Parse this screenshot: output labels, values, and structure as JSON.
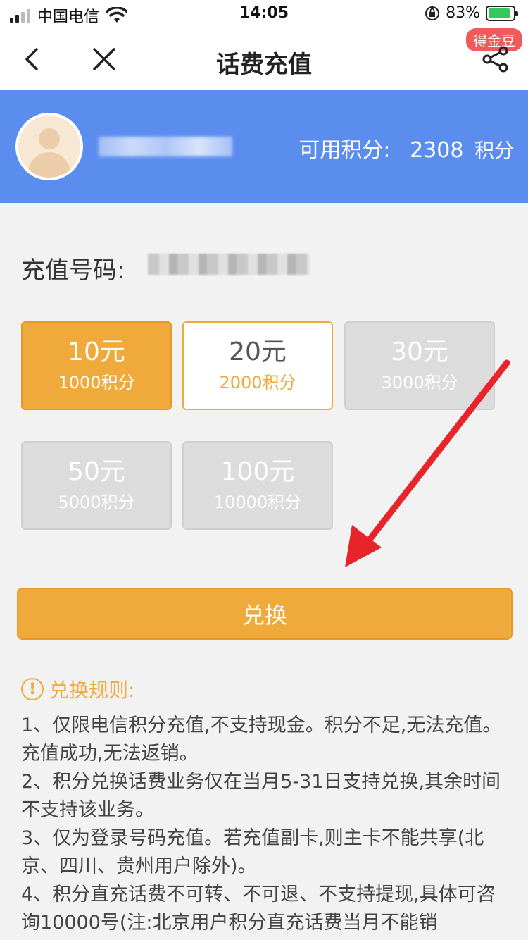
{
  "status_bar": {
    "carrier": "中国电信",
    "time": "14:05",
    "battery_percent": "83%"
  },
  "nav": {
    "title": "话费充值",
    "badge": "得金豆"
  },
  "header": {
    "points_label": "可用积分:",
    "points_value": "2308",
    "points_unit": "积分"
  },
  "recharge": {
    "number_label": "充值号码:"
  },
  "options": [
    {
      "amount": "10元",
      "points": "1000积分",
      "state": "selected"
    },
    {
      "amount": "20元",
      "points": "2000积分",
      "state": "available"
    },
    {
      "amount": "30元",
      "points": "3000积分",
      "state": "disabled"
    },
    {
      "amount": "50元",
      "points": "5000积分",
      "state": "disabled"
    },
    {
      "amount": "100元",
      "points": "10000积分",
      "state": "disabled"
    }
  ],
  "exchange_button": "兑换",
  "rules": {
    "title": "兑换规则:",
    "items": [
      "1、仅限电信积分充值,不支持现金。积分不足,无法充值。充值成功,无法返销。",
      "2、积分兑换话费业务仅在当月5-31日支持兑换,其余时间不支持该业务。",
      "3、仅为登录号码充值。若充值副卡,则主卡不能共享(北京、四川、贵州用户除外)。",
      "4、积分直充话费不可转、不可退、不支持提现,具体可咨询10000号(注:北京用户积分直充话费当月不能销"
    ]
  },
  "colors": {
    "accent": "#f0aa3c",
    "header_bg": "#5b8def",
    "badge": "#f05a5a",
    "annotation_arrow": "#e8242a"
  }
}
